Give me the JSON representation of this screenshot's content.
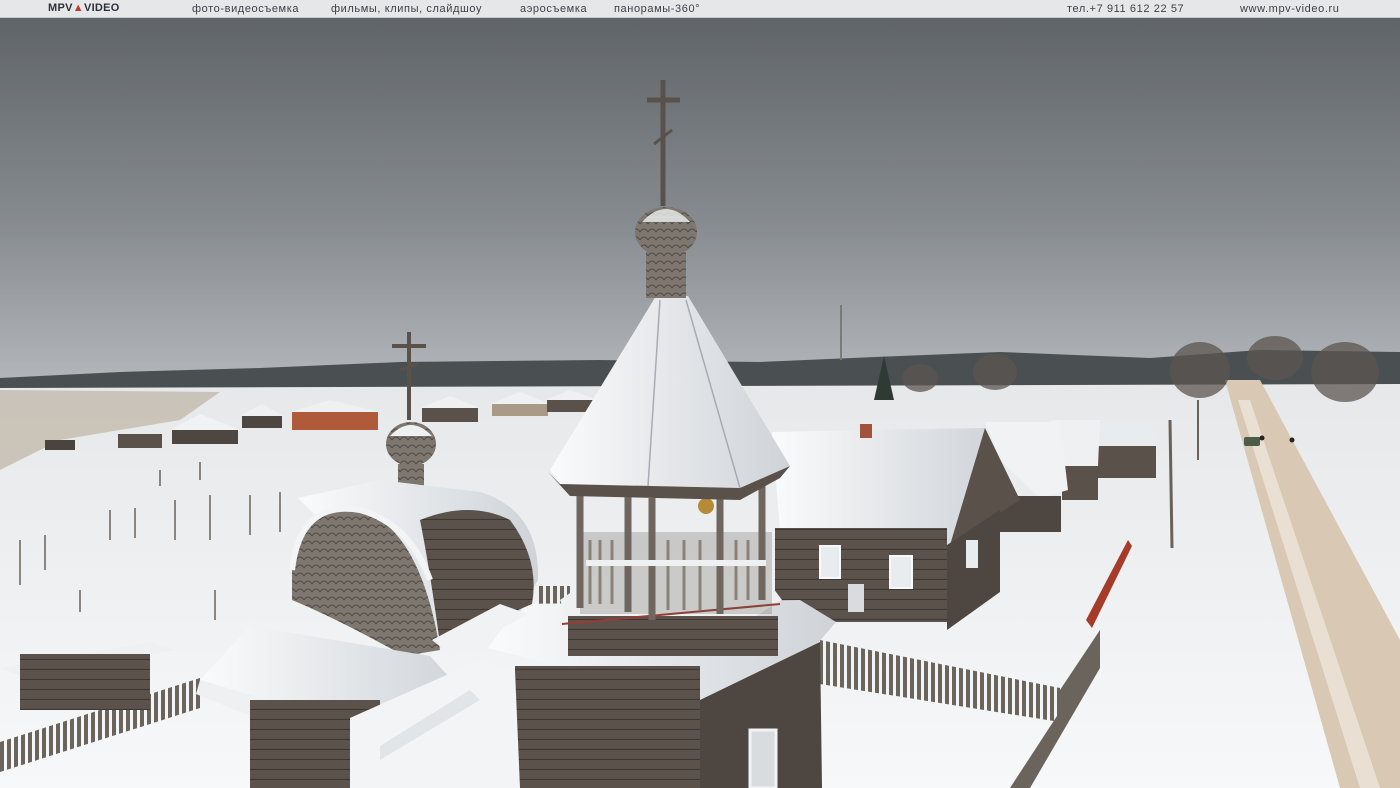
{
  "header": {
    "logo_left": "MPV",
    "logo_mid": "▲",
    "logo_right": "VIDEO",
    "menu": [
      "фото-видеосъемка",
      "фильмы, клипы, слайдшоу",
      "аэросъемка",
      "панорамы-360°"
    ],
    "phone": "тел.+7 911 612 22 57",
    "site": "www.mpv-video.ru"
  },
  "colors": {
    "sky": "#6e7378",
    "snow": "#f3f4f6",
    "wood": "#5a524a",
    "accent": "#c0392b"
  }
}
